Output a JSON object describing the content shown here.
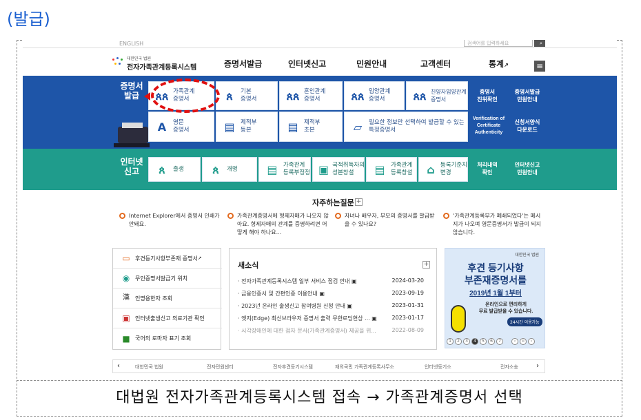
{
  "heading": "(발급)",
  "caption": "대법원 전자가족관계등록시스템 접속 → 가족관계증명서 선택",
  "util": {
    "english": "ENGLISH",
    "search_placeholder": "검색어를 입력하세요"
  },
  "logo": {
    "small": "대한민국 법원",
    "name": "전자가족관계등록시스템"
  },
  "menu": [
    "증명서발급",
    "인터넷신고",
    "민원안내",
    "고객센터",
    "통계"
  ],
  "blue": {
    "title": "증명서\n발급",
    "cards": [
      {
        "icon": "family-icon",
        "label": "가족관계\n증명서"
      },
      {
        "icon": "person-icon",
        "label": "기본\n증명서"
      },
      {
        "icon": "marriage-icon",
        "label": "혼인관계\n증명서"
      },
      {
        "icon": "adoption-icon",
        "label": "입양관계\n증명서"
      },
      {
        "icon": "adoption-icon",
        "label": "친양자입양관계\n증명서"
      },
      {
        "icon": "english-doc-icon",
        "label": "영문\n증명서"
      },
      {
        "icon": "removed-doc-icon",
        "label": "제적부\n등본"
      },
      {
        "icon": "removed-doc-icon",
        "label": "제적부\n초본"
      },
      {
        "icon": "select-doc-icon",
        "label": "필요한 정보만 선택하여 발급할 수 있는\n특정증명서"
      }
    ],
    "side": [
      "증명서\n진위확인",
      "증명서발급\n민원안내",
      "Verification of\nCertificate\nAuthenticity",
      "신청서양식\n다운로드"
    ]
  },
  "teal": {
    "title": "인터넷\n신고",
    "cards": [
      {
        "icon": "birth-icon",
        "label": "출생"
      },
      {
        "icon": "rename-icon",
        "label": "개명"
      },
      {
        "icon": "registry-doc-icon",
        "label": "가족관계\n등록부정정"
      },
      {
        "icon": "nationality-icon",
        "label": "국적취득자의\n성본창설"
      },
      {
        "icon": "registry-doc-icon",
        "label": "가족관계\n등록창설"
      },
      {
        "icon": "home-icon",
        "label": "등록기준지\n변경"
      }
    ],
    "side": [
      "처리내역\n확인",
      "인터넷신고\n민원안내"
    ]
  },
  "faq": {
    "title": "자주하는질문",
    "items": [
      "Internet Explorer에서 증명서 인쇄가 안돼요.",
      "가족관계증명서에 형제자매가 나오지 않아요. 형제자매의 관계를 증명하려면 어떻게 해야 하나요...",
      "자녀나 배우자, 부모의 증명서를 발급받을 수 있나요?",
      "'가족관계등록부가 폐쇄되었다'는 메시지가 나오며 영문증명서가 발급이 되지 않습니다."
    ]
  },
  "quick": [
    {
      "icon": "document-icon",
      "label": "후견등기사항부존재 증명서"
    },
    {
      "icon": "location-icon",
      "label": "무인증명서발급기 위치"
    },
    {
      "icon": "hanja-icon",
      "label": "인명용한자 조회"
    },
    {
      "icon": "hospital-icon",
      "label": "인터넷출생신고 의료기관 확인"
    },
    {
      "icon": "book-icon",
      "label": "국어의 로마자 표기 조회"
    }
  ],
  "news": {
    "title": "새소식",
    "items": [
      {
        "title": "전자가족관계등록시스템 일부 서비스 점검 안내",
        "date": "2024-03-20"
      },
      {
        "title": "금융인증서 및 간편인증 이용안내",
        "date": "2023-09-19"
      },
      {
        "title": "2023년 온라인 출생신고 참여병원 신청 안내",
        "date": "2023-01-31"
      },
      {
        "title": "엣지(Edge) 최신브라우저 증명서 출력 무한로딩현상 ...",
        "date": "2023-01-17"
      },
      {
        "title": "시각장애인에 대한 점자 문서(가족관계증명서) 제공을 위...",
        "date": "2022-08-09"
      }
    ]
  },
  "banner": {
    "top": "대한민국 법원",
    "line1": "후견 등기사항",
    "line2": "부존재증명서를",
    "line3": "2019년 1월 1부터",
    "line4": "온라인으로 편리하게",
    "line5": "무료 발급받을 수 있습니다.",
    "badge": "24시간 이용가능",
    "pages": [
      "1",
      "2",
      "3",
      "4",
      "5",
      "6",
      "7"
    ]
  },
  "footer": [
    "대한민국 법원",
    "전자민원센터",
    "전자후견등기시스템",
    "재외국민 가족관계등록사무소",
    "인터넷등기소",
    "전자소송"
  ]
}
